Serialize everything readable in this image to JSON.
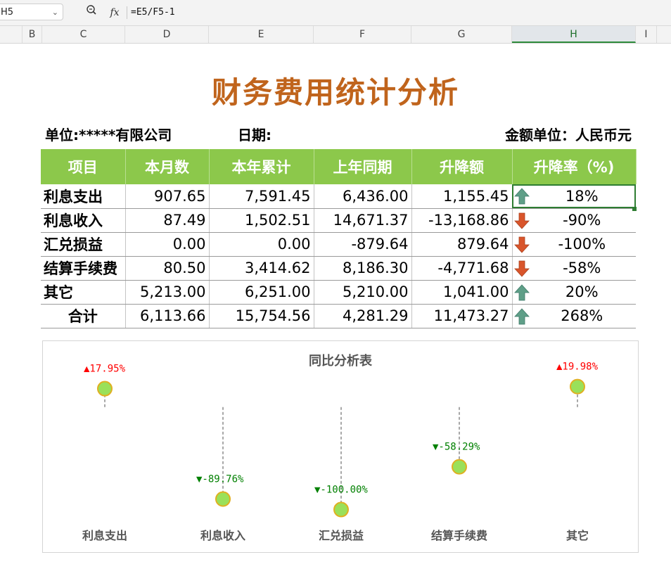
{
  "formula_bar": {
    "name_box": "H5",
    "zoom_icon": "magnifier-icon",
    "fx_label": "fx",
    "formula": "=E5/F5-1"
  },
  "columns": [
    "B",
    "C",
    "D",
    "E",
    "F",
    "G",
    "H",
    "I"
  ],
  "active_column": "H",
  "report": {
    "title": "财务费用统计分析",
    "unit": "单位:*****有限公司",
    "date": "日期:",
    "currency": "金额单位：人民币元",
    "headers": [
      "项目",
      "本月数",
      "本年累计",
      "上年同期",
      "升降额",
      "升降率（%)"
    ],
    "rows": [
      {
        "name": "利息支出",
        "month": "907.65",
        "ytd": "7,591.45",
        "last_year": "6,436.00",
        "change": "1,155.45",
        "trend": "up",
        "rate": "18%"
      },
      {
        "name": "利息收入",
        "month": "87.49",
        "ytd": "1,502.51",
        "last_year": "14,671.37",
        "change": "-13,168.86",
        "trend": "down",
        "rate": "-90%"
      },
      {
        "name": "汇兑损益",
        "month": "0.00",
        "ytd": "0.00",
        "last_year": "-879.64",
        "change": "879.64",
        "trend": "down",
        "rate": "-100%"
      },
      {
        "name": "结算手续费",
        "month": "80.50",
        "ytd": "3,414.62",
        "last_year": "8,186.30",
        "change": "-4,771.68",
        "trend": "down",
        "rate": "-58%"
      },
      {
        "name": "其它",
        "month": "5,213.00",
        "ytd": "6,251.00",
        "last_year": "5,210.00",
        "change": "1,041.00",
        "trend": "up",
        "rate": "20%"
      },
      {
        "name": "合计",
        "month": "6,113.66",
        "ytd": "15,754.56",
        "last_year": "4,281.29",
        "change": "11,473.27",
        "trend": "up",
        "rate": "268%"
      }
    ],
    "colors": {
      "header_bg": "#8cc84b",
      "title": "#c0641c",
      "up_arrow": "#5f9f88",
      "down_arrow": "#d9552b"
    }
  },
  "chart_data": {
    "type": "scatter",
    "title": "同比分析表",
    "categories": [
      "利息支出",
      "利息收入",
      "汇兑损益",
      "结算手续费",
      "其它"
    ],
    "values": [
      17.95,
      -89.76,
      -100.0,
      -58.29,
      19.98
    ],
    "labels": [
      "▲17.95%",
      "▼-89.76%",
      "▼-100.00%",
      "▼-58.29%",
      "▲19.98%"
    ],
    "ylim": [
      -110,
      30
    ],
    "colors": {
      "marker_fill": "#9ae05a",
      "marker_edge": "#e0b020",
      "positive": "#ff0000",
      "negative": "#008000",
      "connector": "#8a8a8a"
    }
  }
}
